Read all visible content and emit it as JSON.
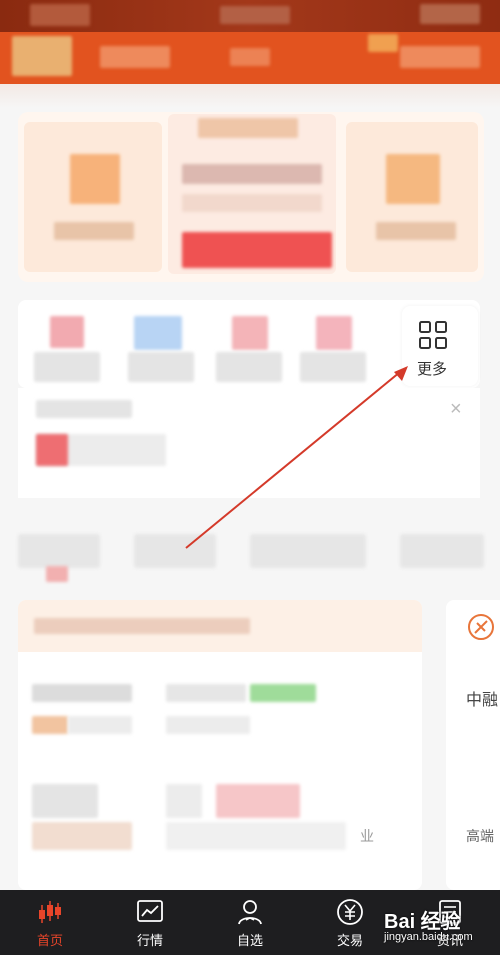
{
  "grid": {
    "more_label": "更多"
  },
  "notice": {
    "close_glyph": "×"
  },
  "side": {
    "text_1": "中融",
    "text_2": "高端"
  },
  "news": {
    "text_fragment": "业"
  },
  "nav": {
    "items": [
      {
        "label": "首页",
        "icon": "candlestick-icon"
      },
      {
        "label": "行情",
        "icon": "chart-line-icon"
      },
      {
        "label": "自选",
        "icon": "user-star-icon"
      },
      {
        "label": "交易",
        "icon": "yuan-icon"
      },
      {
        "label": "资讯",
        "icon": "news-icon"
      }
    ]
  },
  "watermark": {
    "brand": "Bai 经验",
    "url": "jingyan.baidu.com"
  },
  "colors": {
    "accent": "#e2531f",
    "active": "#e8452a",
    "arrow": "#d43a2a",
    "nav_bg": "#1e1e20"
  }
}
